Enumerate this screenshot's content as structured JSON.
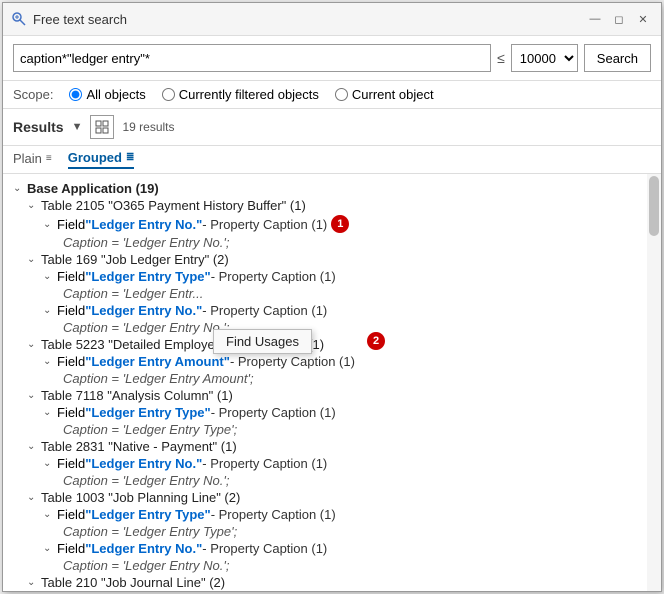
{
  "titleBar": {
    "title": "Free text search",
    "minimizeLabel": "minimize",
    "maximizeLabel": "maximize",
    "closeLabel": "close"
  },
  "searchBar": {
    "query": "caption*\"ledger entry\"*",
    "limitSymbol": "≤",
    "limitOptions": [
      "10000"
    ],
    "selectedLimit": "10000",
    "searchButtonLabel": "Search"
  },
  "scope": {
    "label": "Scope:",
    "options": [
      {
        "id": "all",
        "label": "All objects",
        "selected": true
      },
      {
        "id": "filtered",
        "label": "Currently filtered objects",
        "selected": false
      },
      {
        "id": "current",
        "label": "Current object",
        "selected": false
      }
    ]
  },
  "results": {
    "title": "Results",
    "count": "19 results"
  },
  "viewTabs": {
    "plain": "Plain",
    "grouped": "Grouped"
  },
  "tree": [
    {
      "id": "base-app",
      "level": 0,
      "text": "Base Application (19)",
      "bold": true
    },
    {
      "id": "table-2105",
      "level": 1,
      "text": "Table 2105 \"O365 Payment History Buffer\" (1)"
    },
    {
      "id": "field-ledger-entry-no-1",
      "level": 2,
      "linkText": "\"Ledger Entry No.\"",
      "suffix": " - Property Caption (1)",
      "badge": "1"
    },
    {
      "id": "caption-1",
      "level": 3,
      "text": "Caption = 'Ledger Entry No.';"
    },
    {
      "id": "table-169",
      "level": 1,
      "text": "Table 169 \"Job Ledger Entry\" (2)"
    },
    {
      "id": "field-ledger-entry-type-1",
      "level": 2,
      "linkText": "\"Ledger Entry Type\"",
      "suffix": " - Property Caption (1)",
      "tooltip": true
    },
    {
      "id": "caption-2",
      "level": 3,
      "text": "Caption = 'Ledger Entr..."
    },
    {
      "id": "field-ledger-entry-no-2",
      "level": 2,
      "linkText": "\"Ledger Entry No.\"",
      "suffix": " - Property Caption (1)"
    },
    {
      "id": "caption-3",
      "level": 3,
      "text": "Caption = 'Ledger Entry No.';"
    },
    {
      "id": "table-5223",
      "level": 1,
      "text": "Table 5223 \"Detailed Employee Ledger Entry\" (1)"
    },
    {
      "id": "field-ledger-entry-amount",
      "level": 2,
      "linkText": "\"Ledger Entry Amount\"",
      "suffix": " - Property Caption (1)"
    },
    {
      "id": "caption-4",
      "level": 3,
      "text": "Caption = 'Ledger Entry Amount';"
    },
    {
      "id": "table-7118",
      "level": 1,
      "text": "Table 7118 \"Analysis Column\" (1)"
    },
    {
      "id": "field-ledger-entry-type-2",
      "level": 2,
      "linkText": "\"Ledger Entry Type\"",
      "suffix": " - Property Caption (1)"
    },
    {
      "id": "caption-5",
      "level": 3,
      "text": "Caption = 'Ledger Entry Type';"
    },
    {
      "id": "table-2831",
      "level": 1,
      "text": "Table 2831 \"Native - Payment\" (1)"
    },
    {
      "id": "field-ledger-entry-no-3",
      "level": 2,
      "linkText": "\"Ledger Entry No.\"",
      "suffix": " - Property Caption (1)"
    },
    {
      "id": "caption-6",
      "level": 3,
      "text": "Caption = 'Ledger Entry No.';"
    },
    {
      "id": "table-1003",
      "level": 1,
      "text": "Table 1003 \"Job Planning Line\" (2)"
    },
    {
      "id": "field-ledger-entry-type-3",
      "level": 2,
      "linkText": "\"Ledger Entry Type\"",
      "suffix": " - Property Caption (1)"
    },
    {
      "id": "caption-7",
      "level": 3,
      "text": "Caption = 'Ledger Entry Type';"
    },
    {
      "id": "field-ledger-entry-no-4",
      "level": 2,
      "linkText": "\"Ledger Entry No.\"",
      "suffix": " - Property Caption (1)"
    },
    {
      "id": "caption-8",
      "level": 3,
      "text": "Caption = 'Ledger Entry No.';"
    },
    {
      "id": "table-210",
      "level": 1,
      "text": "Table 210 \"Job Journal Line\" (2)"
    }
  ],
  "tooltipMenu": {
    "label": "Find Usages",
    "badge": "2"
  }
}
